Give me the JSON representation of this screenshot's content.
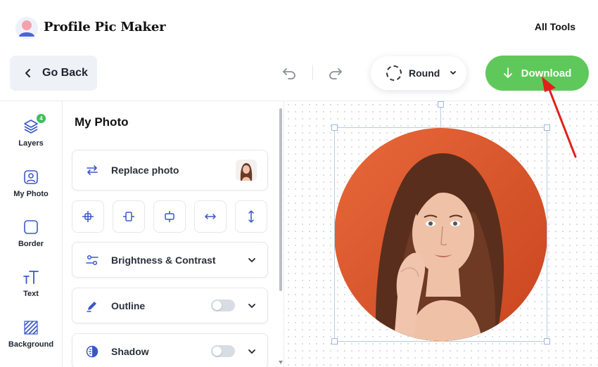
{
  "header": {
    "brand": "Profile Pic Maker",
    "all_tools": "All Tools"
  },
  "toolbar": {
    "go_back": "Go Back",
    "shape": "Round",
    "download": "Download"
  },
  "rail": {
    "items": [
      {
        "label": "Layers",
        "icon": "layers-icon",
        "badge": "4"
      },
      {
        "label": "My Photo",
        "icon": "photo-icon"
      },
      {
        "label": "Border",
        "icon": "border-icon"
      },
      {
        "label": "Text",
        "icon": "text-icon"
      },
      {
        "label": "Background",
        "icon": "background-icon"
      }
    ]
  },
  "panel": {
    "title": "My Photo",
    "replace_photo": "Replace photo",
    "align_buttons": [
      "align-center-icon",
      "align-vertical-center-icon",
      "align-horizontal-center-icon",
      "stretch-horizontal-icon",
      "stretch-vertical-icon"
    ],
    "brightness": "Brightness & Contrast",
    "outline": "Outline",
    "outline_enabled": false,
    "shadow": "Shadow",
    "shadow_enabled": false
  },
  "colors": {
    "accent_green": "#5ec95a",
    "badge_green": "#3fbf5a",
    "photo_bg": "#d9562a",
    "arrow_red": "#e0201b"
  }
}
